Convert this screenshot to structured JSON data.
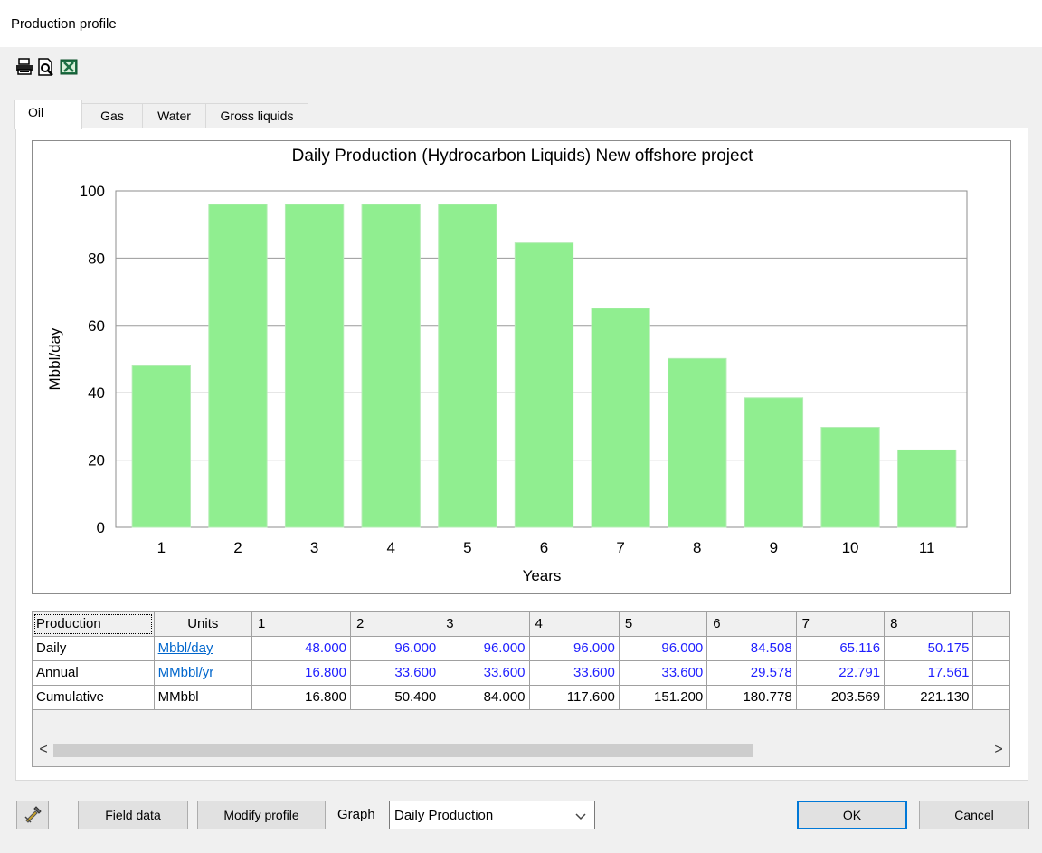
{
  "window": {
    "title": "Production profile"
  },
  "toolbar": {
    "icons": [
      "printer-icon",
      "print-preview-icon",
      "excel-export-icon"
    ]
  },
  "tabs": [
    {
      "label": "Oil",
      "active": true
    },
    {
      "label": "Gas",
      "active": false
    },
    {
      "label": "Water",
      "active": false
    },
    {
      "label": "Gross liquids",
      "active": false
    }
  ],
  "chart_data": {
    "type": "bar",
    "title": "Daily Production (Hydrocarbon Liquids) New offshore project",
    "xlabel": "Years",
    "ylabel": "Mbbl/day",
    "categories": [
      "1",
      "2",
      "3",
      "4",
      "5",
      "6",
      "7",
      "8",
      "9",
      "10",
      "11"
    ],
    "values": [
      48.0,
      96.0,
      96.0,
      96.0,
      96.0,
      84.508,
      65.116,
      50.175,
      38.5,
      29.7,
      23.0
    ],
    "ylim": [
      0,
      100
    ],
    "yticks": [
      0,
      20,
      40,
      60,
      80,
      100
    ],
    "grid": true,
    "bar_color": "#90ee90"
  },
  "table": {
    "header": [
      "Production",
      "Units",
      "1",
      "2",
      "3",
      "4",
      "5",
      "6",
      "7",
      "8"
    ],
    "rows": [
      {
        "label": "Daily",
        "units": "Mbbl/day",
        "units_link": true,
        "values": [
          "48.000",
          "96.000",
          "96.000",
          "96.000",
          "96.000",
          "84.508",
          "65.116",
          "50.175"
        ],
        "color": "#1f1fff"
      },
      {
        "label": "Annual",
        "units": "MMbbl/yr",
        "units_link": true,
        "values": [
          "16.800",
          "33.600",
          "33.600",
          "33.600",
          "33.600",
          "29.578",
          "22.791",
          "17.561"
        ],
        "color": "#1f1fff"
      },
      {
        "label": "Cumulative",
        "units": "MMbbl",
        "units_link": false,
        "values": [
          "16.800",
          "50.400",
          "84.000",
          "117.600",
          "151.200",
          "180.778",
          "203.569",
          "221.130"
        ],
        "color": "#000000"
      }
    ]
  },
  "buttons": {
    "tool": "tool-icon",
    "field_data": "Field data",
    "modify_profile": "Modify profile",
    "ok": "OK",
    "cancel": "Cancel"
  },
  "graph_select": {
    "label": "Graph",
    "value": "Daily Production"
  },
  "scrollbar": {
    "left_arrow": "<",
    "right_arrow": ">"
  }
}
